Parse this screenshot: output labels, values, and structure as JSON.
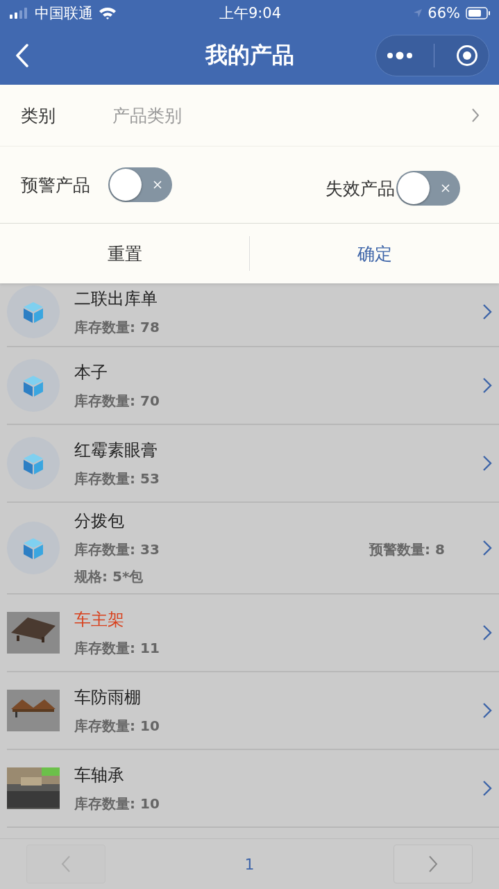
{
  "status_bar": {
    "carrier": "中国联通",
    "time": "上午9:04",
    "battery": "66%"
  },
  "nav": {
    "title": "我的产品"
  },
  "filter": {
    "category_label": "类别",
    "category_placeholder": "产品类别",
    "toggles": [
      {
        "label": "预警产品",
        "on": false
      },
      {
        "label": "失效产品",
        "on": false
      }
    ],
    "buttons": [
      {
        "label": "重置",
        "primary": false
      },
      {
        "label": "确定",
        "primary": true
      }
    ]
  },
  "products": [
    {
      "kind": "cube",
      "name": "二联出库单",
      "warning": false,
      "stock": "库存数量: 78"
    },
    {
      "kind": "cube",
      "name": "本子",
      "warning": false,
      "stock": "库存数量: 70"
    },
    {
      "kind": "cube",
      "name": "红霉素眼膏",
      "warning": false,
      "stock": "库存数量: 53"
    },
    {
      "kind": "cube",
      "name": "分拨包",
      "warning": false,
      "stock": "库存数量: 33",
      "alert": "预警数量: 8",
      "spec": "规格: 5*包"
    },
    {
      "kind": "picture",
      "name": "车主架",
      "warning": true,
      "stock": "库存数量: 11"
    },
    {
      "kind": "picture",
      "name": "车防雨棚",
      "warning": false,
      "stock": "库存数量: 10"
    },
    {
      "kind": "picture",
      "name": "车轴承",
      "warning": false,
      "stock": "库存数量: 10"
    }
  ],
  "pager": {
    "page": "1",
    "prev_disabled": true
  }
}
